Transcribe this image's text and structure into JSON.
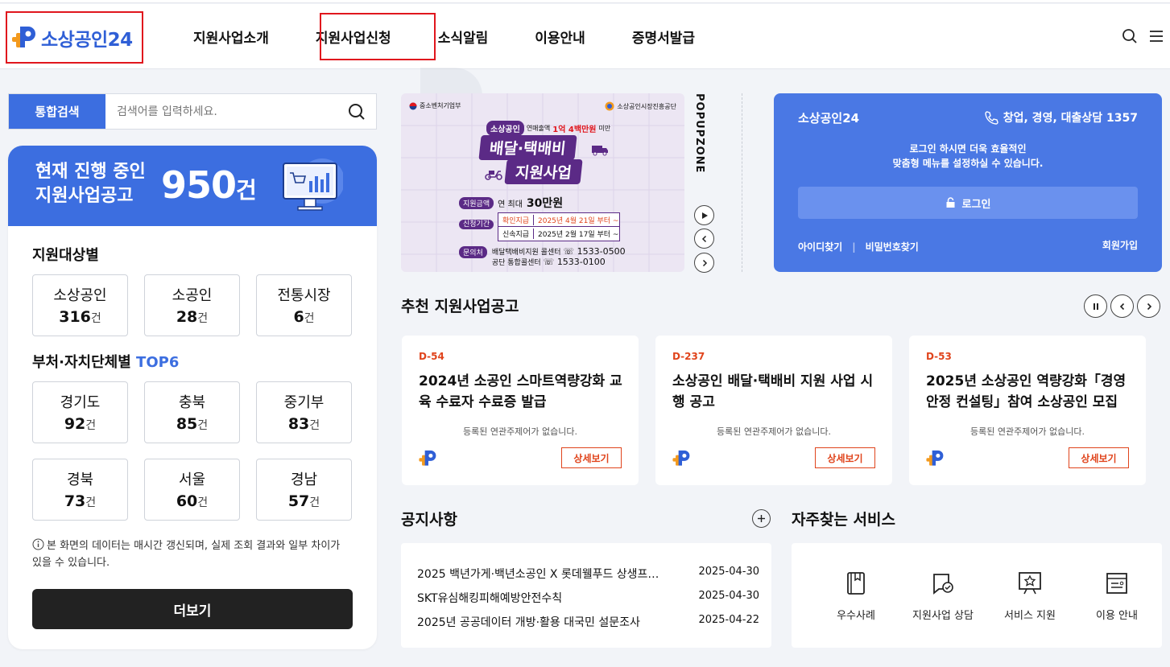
{
  "header": {
    "logo_text": "소상공인24",
    "nav": [
      "지원사업소개",
      "지원사업신청",
      "소식알림",
      "이용안내",
      "증명서발급"
    ],
    "icons": [
      "search-icon",
      "menu-icon"
    ]
  },
  "search": {
    "tag": "통합검색",
    "placeholder": "검색어를 입력하세요."
  },
  "summary": {
    "banner_line1": "현재 진행 중인",
    "banner_line2": "지원사업공고",
    "count": "950",
    "count_unit": "건",
    "target_title": "지원대상별",
    "targets": [
      {
        "label": "소상공인",
        "value": "316",
        "unit": "건"
      },
      {
        "label": "소공인",
        "value": "28",
        "unit": "건"
      },
      {
        "label": "전통시장",
        "value": "6",
        "unit": "건"
      }
    ],
    "region_title": "부처·자치단체별",
    "region_title_accent": "TOP6",
    "regions": [
      {
        "label": "경기도",
        "value": "92",
        "unit": "건"
      },
      {
        "label": "충북",
        "value": "85",
        "unit": "건"
      },
      {
        "label": "중기부",
        "value": "83",
        "unit": "건"
      },
      {
        "label": "경북",
        "value": "73",
        "unit": "건"
      },
      {
        "label": "서울",
        "value": "60",
        "unit": "건"
      },
      {
        "label": "경남",
        "value": "57",
        "unit": "건"
      }
    ],
    "note": "본 화면의 데이터는 매시간 갱신되며, 실제 조회 결과와 일부 차이가 있을 수 있습니다.",
    "more_label": "더보기"
  },
  "popup": {
    "zone_label": "POPUPZONE",
    "org_left": "중소벤처기업부",
    "org_right": "소상공인시장진흥공단",
    "tag": "소상공인",
    "tag_sub": "연매출액",
    "amount_note": "1억 4백만원",
    "amount_suffix": "미만",
    "title1": "배달·택배비",
    "title2": "지원사업",
    "label_amount": "지원금액",
    "amount_text": "연 최대",
    "amount_value": "30만원",
    "label_period": "신청기간",
    "period1_label": "확인지급",
    "period1_value": "2025년 4월 21일 부터 ~",
    "period2_label": "신속지급",
    "period2_value": "2025년 2월 17일 부터 ~",
    "label_contact": "문의처",
    "contact1": "배달택배비지원 콜센터",
    "contact1_phone": "1533-0500",
    "contact2": "공단 통합콜센터",
    "contact2_phone": "1533-0100"
  },
  "login": {
    "brand": "소상공인24",
    "phone": "창업, 경영, 대출상담 1357",
    "msg1": "로그인 하시면 더욱 효율적인",
    "msg2": "맞춤형 메뉴를 설정하실 수 있습니다.",
    "button": "로그인",
    "find_id": "아이디찾기",
    "find_pw": "비밀번호찾기",
    "join": "회원가입"
  },
  "recommended": {
    "title": "추천 지원사업공고",
    "cards": [
      {
        "dday": "D-54",
        "title": "2024년 소공인 스마트역량강화 교육 수료자 수료증 발급",
        "sub": "등록된 연관주제어가 없습니다.",
        "button": "상세보기"
      },
      {
        "dday": "D-237",
        "title": "소상공인 배달·택배비 지원 사업 시행 공고",
        "sub": "등록된 연관주제어가 없습니다.",
        "button": "상세보기"
      },
      {
        "dday": "D-53",
        "title": "2025년 소상공인 역량강화「경영안정 컨설팅」참여 소상공인 모집 공…",
        "sub": "등록된 연관주제어가 없습니다.",
        "button": "상세보기"
      }
    ]
  },
  "notices": {
    "title": "공지사항",
    "items": [
      {
        "title": "2025 백년가게·백년소공인 X 롯데웰푸드 상생프…",
        "date": "2025-04-30"
      },
      {
        "title": "SKT유심해킹피해예방안전수칙",
        "date": "2025-04-30"
      },
      {
        "title": "2025년 공공데이터 개방·활용 대국민 설문조사",
        "date": "2025-04-22"
      }
    ]
  },
  "services": {
    "title": "자주찾는 서비스",
    "items": [
      {
        "label": "우수사례",
        "icon": "bookmark-book-icon"
      },
      {
        "label": "지원사업 상담",
        "icon": "consult-check-icon"
      },
      {
        "label": "서비스 지원",
        "icon": "award-board-icon"
      },
      {
        "label": "이용 안내",
        "icon": "guide-document-icon"
      }
    ]
  },
  "colors": {
    "primary": "#3c6ee0",
    "login_bg": "#4a78e4",
    "accent_orange": "#e0441c",
    "highlight_red": "#e0161d",
    "dark_button": "#222222"
  }
}
